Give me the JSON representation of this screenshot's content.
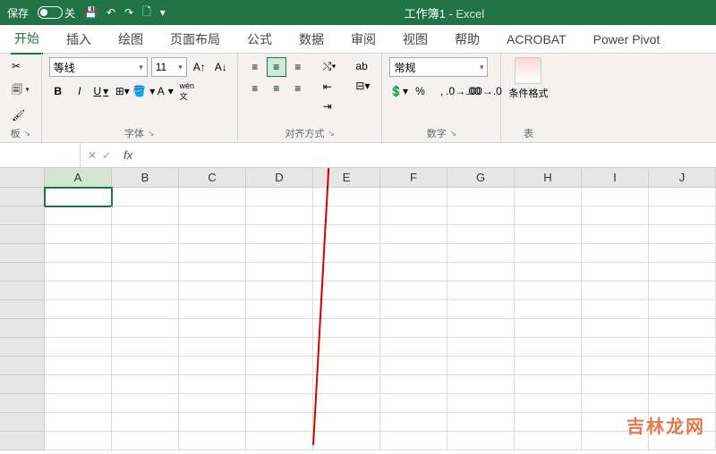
{
  "titlebar": {
    "save_label": "保存",
    "toggle_label": "关",
    "doc_title": "工作簿1",
    "app_name": "Excel"
  },
  "tabs": [
    {
      "label": "开始",
      "active": true
    },
    {
      "label": "插入"
    },
    {
      "label": "绘图"
    },
    {
      "label": "页面布局"
    },
    {
      "label": "公式"
    },
    {
      "label": "数据"
    },
    {
      "label": "审阅"
    },
    {
      "label": "视图"
    },
    {
      "label": "帮助"
    },
    {
      "label": "ACROBAT"
    },
    {
      "label": "Power Pivot"
    }
  ],
  "groups": {
    "clipboard": {
      "label": "板"
    },
    "font": {
      "label": "字体",
      "name": "等线",
      "size": "11",
      "increase": "A▲",
      "decrease": "A▼",
      "bold": "B",
      "italic": "I",
      "underline": "U",
      "ruby": "wén 文"
    },
    "align": {
      "label": "对齐方式",
      "wrap": "ab"
    },
    "number": {
      "label": "数字",
      "format": "常规",
      "percent": "%",
      "comma": ","
    },
    "styles": {
      "cond_format": "条件格式",
      "more": "表"
    }
  },
  "columns": [
    "A",
    "B",
    "C",
    "D",
    "E",
    "F",
    "G",
    "H",
    "I",
    "J"
  ],
  "watermark": "吉林龙网"
}
